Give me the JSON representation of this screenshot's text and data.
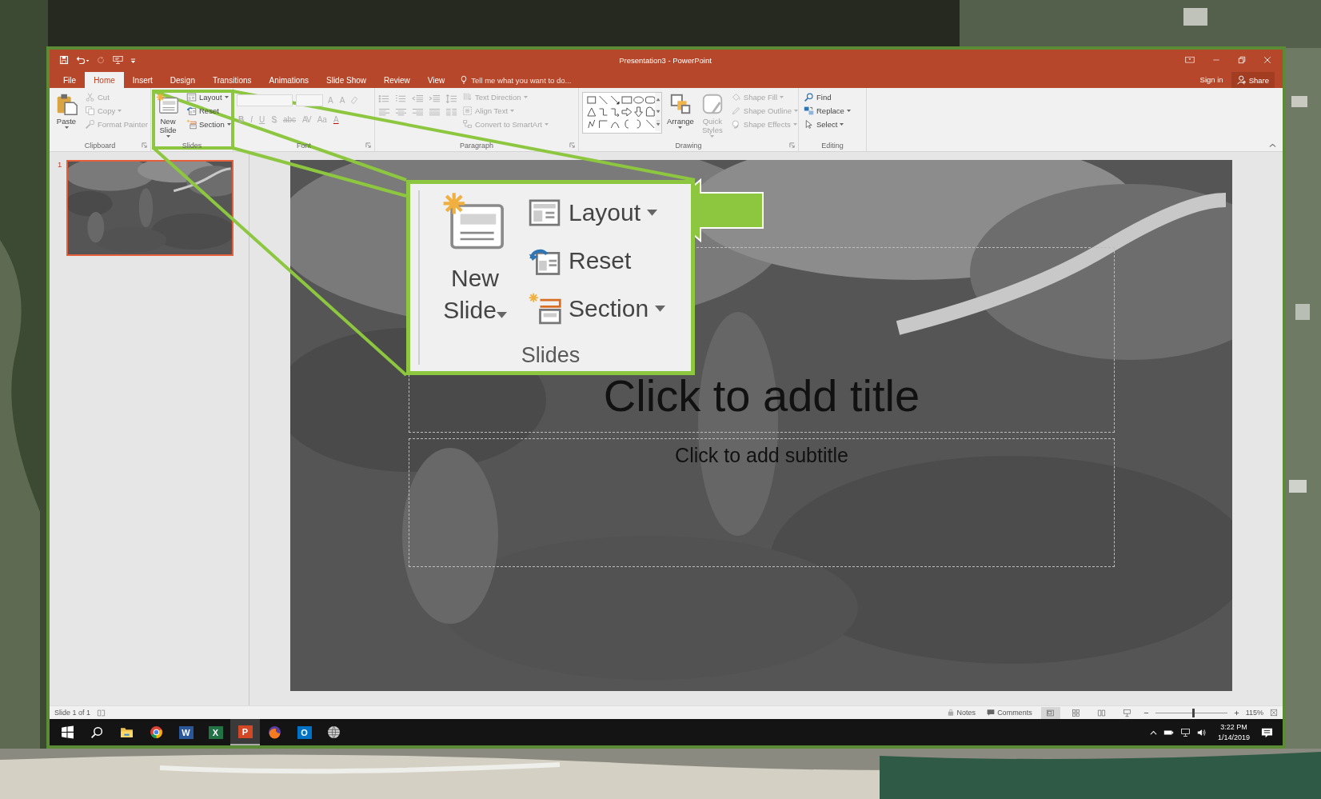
{
  "window": {
    "title": "Presentation3 - PowerPoint",
    "sign_in": "Sign in",
    "share": "Share"
  },
  "tabs": [
    {
      "label": "File",
      "selected": false
    },
    {
      "label": "Home",
      "selected": true
    },
    {
      "label": "Insert",
      "selected": false
    },
    {
      "label": "Design",
      "selected": false
    },
    {
      "label": "Transitions",
      "selected": false
    },
    {
      "label": "Animations",
      "selected": false
    },
    {
      "label": "Slide Show",
      "selected": false
    },
    {
      "label": "Review",
      "selected": false
    },
    {
      "label": "View",
      "selected": false
    }
  ],
  "tell_me": {
    "placeholder": "Tell me what you want to do..."
  },
  "ribbon": {
    "groups": [
      {
        "kind": "commands",
        "label": "Clipboard",
        "launcher": true,
        "commands": [
          {
            "kind": "large",
            "label": "Paste",
            "dropdown": true,
            "disabled": false
          },
          {
            "kind": "small",
            "label": "Cut",
            "dropdown": false,
            "disabled": true
          },
          {
            "kind": "small",
            "label": "Copy",
            "dropdown": true,
            "disabled": true
          },
          {
            "kind": "small",
            "label": "Format Painter",
            "dropdown": false,
            "disabled": true
          }
        ]
      },
      {
        "kind": "commands",
        "label": "Slides",
        "launcher": false,
        "commands": [
          {
            "kind": "large",
            "label": "New Slide",
            "dropdown": true,
            "disabled": false
          },
          {
            "kind": "small",
            "label": "Layout",
            "dropdown": true,
            "disabled": false
          },
          {
            "kind": "small",
            "label": "Reset",
            "dropdown": false,
            "disabled": false
          },
          {
            "kind": "small",
            "label": "Section",
            "dropdown": true,
            "disabled": false
          }
        ]
      },
      {
        "kind": "font",
        "label": "Font",
        "launcher": true,
        "disabled": true,
        "row1": [
          {
            "label": "A"
          },
          {
            "label": "A"
          }
        ],
        "row2": [
          {
            "label": "B"
          },
          {
            "label": "I"
          },
          {
            "label": "U"
          },
          {
            "label": "S"
          },
          {
            "label": "abc"
          },
          {
            "label": "AV"
          },
          {
            "label": "Aa"
          },
          {
            "label": "A"
          }
        ]
      },
      {
        "kind": "paragraph",
        "label": "Paragraph",
        "launcher": true,
        "disabled": true,
        "commands": [
          {
            "kind": "small",
            "label": "Text Direction",
            "dropdown": true,
            "disabled": true
          },
          {
            "kind": "small",
            "label": "Align Text",
            "dropdown": true,
            "disabled": true
          },
          {
            "kind": "small",
            "label": "Convert to SmartArt",
            "dropdown": true,
            "disabled": true
          }
        ]
      },
      {
        "kind": "drawing",
        "label": "Drawing",
        "launcher": true,
        "commands": [
          {
            "kind": "large",
            "label": "Arrange",
            "dropdown": true,
            "disabled": false
          },
          {
            "kind": "large",
            "label": "Quick Styles",
            "dropdown": true,
            "disabled": true
          },
          {
            "kind": "small",
            "label": "Shape Fill",
            "dropdown": true,
            "disabled": true
          },
          {
            "kind": "small",
            "label": "Shape Outline",
            "dropdown": true,
            "disabled": true
          },
          {
            "kind": "small",
            "label": "Shape Effects",
            "dropdown": true,
            "disabled": true
          }
        ]
      },
      {
        "kind": "commands",
        "label": "Editing",
        "launcher": false,
        "commands": [
          {
            "kind": "small",
            "label": "Find",
            "dropdown": false,
            "disabled": false
          },
          {
            "kind": "small",
            "label": "Replace",
            "dropdown": true,
            "disabled": false
          },
          {
            "kind": "small",
            "label": "Select",
            "dropdown": true,
            "disabled": false
          }
        ]
      }
    ]
  },
  "thumbnails": [
    {
      "number": "1",
      "selected": true
    }
  ],
  "slide": {
    "title": "Click to add title",
    "subtitle": "Click to add subtitle"
  },
  "callout": {
    "new_slide": {
      "label": "New Slide",
      "dropdown": true
    },
    "commands": [
      {
        "label": "Layout",
        "dropdown": true
      },
      {
        "label": "Reset",
        "dropdown": false
      },
      {
        "label": "Section",
        "dropdown": true
      }
    ],
    "group_label": "Slides"
  },
  "status_bar": {
    "slide_count": "Slide 1 of 1",
    "notes": "Notes",
    "comments": "Comments",
    "views": [
      {
        "selected": true
      },
      {
        "selected": false
      },
      {
        "selected": false
      },
      {
        "selected": false
      }
    ],
    "zoom": {
      "level": 0.53,
      "reading": "115%"
    }
  },
  "taskbar": {
    "apps": [
      {
        "kind": "start",
        "selected": false
      },
      {
        "kind": "search",
        "selected": false
      },
      {
        "kind": "folder",
        "selected": false
      },
      {
        "kind": "browser",
        "selected": false
      },
      {
        "kind": "tile",
        "letter": "W",
        "color": "#2b579a",
        "selected": false
      },
      {
        "kind": "tile",
        "letter": "X",
        "color": "#217346",
        "selected": false
      },
      {
        "kind": "tile",
        "letter": "P",
        "color": "#d24726",
        "selected": true
      },
      {
        "kind": "fox",
        "selected": false
      },
      {
        "kind": "tile",
        "letter": "O",
        "color": "#0072c6",
        "selected": false
      },
      {
        "kind": "globe",
        "selected": false
      }
    ],
    "time": "3:22 PM",
    "date": "1/14/2019"
  }
}
